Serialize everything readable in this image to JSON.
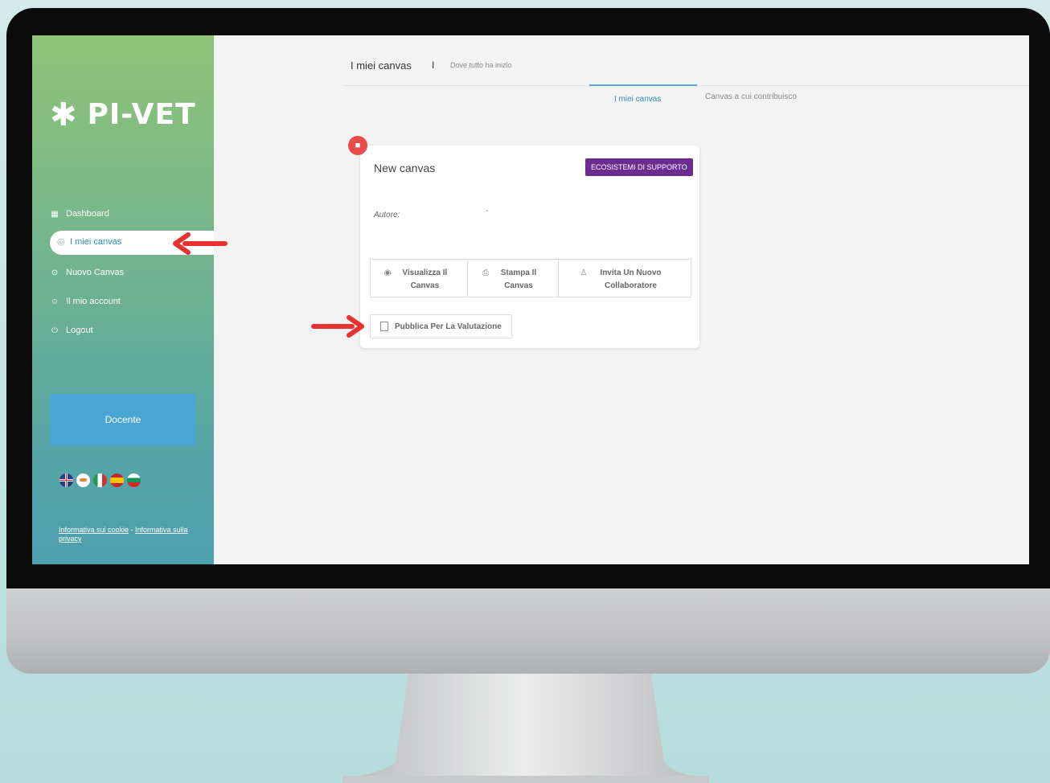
{
  "app": {
    "logo_text": "PI-VET"
  },
  "sidebar": {
    "items": [
      {
        "label": "Dashboard",
        "icon": "dashboard-grid-icon"
      },
      {
        "label": "I miei canvas",
        "icon": "globe-icon",
        "active": true
      },
      {
        "label": "Nuovo Canvas",
        "icon": "plus-circle-icon"
      },
      {
        "label": "Il mio account",
        "icon": "user-icon"
      },
      {
        "label": "Logout",
        "icon": "power-icon"
      }
    ],
    "role": "Docente",
    "languages": [
      "en-flag",
      "cy-flag",
      "it-flag",
      "es-flag",
      "bg-flag"
    ],
    "footer": {
      "cookie_link": "Informativa sui cookie",
      "separator": " - ",
      "privacy_link": "Informativa sulla privacy"
    }
  },
  "header": {
    "title": "I miei canvas",
    "separator": "I",
    "subtitle": "Dove tutto ha inizio"
  },
  "tabs": [
    {
      "label": "I miei canvas",
      "active": true
    },
    {
      "label": "Canvas a cui contribuisco",
      "active": false
    }
  ],
  "card": {
    "title": "New canvas",
    "badge": "ECOSISTEMI DI SUPPORTO",
    "author_label": "Autore:",
    "author_value": "-",
    "actions": [
      {
        "label": "Visualizza Il Canvas",
        "icon": "eye-icon"
      },
      {
        "label": "Stampa Il Canvas",
        "icon": "print-icon"
      },
      {
        "label": "Invita Un Nuovo Collaboratore",
        "icon": "user-icon"
      }
    ],
    "publish_label": "Pubblica Per La Valutazione"
  },
  "colors": {
    "accent": "#2f8fb7",
    "badge": "#6a2c91",
    "delete": "#e84c4c",
    "annotation_arrow": "#e8322f"
  }
}
